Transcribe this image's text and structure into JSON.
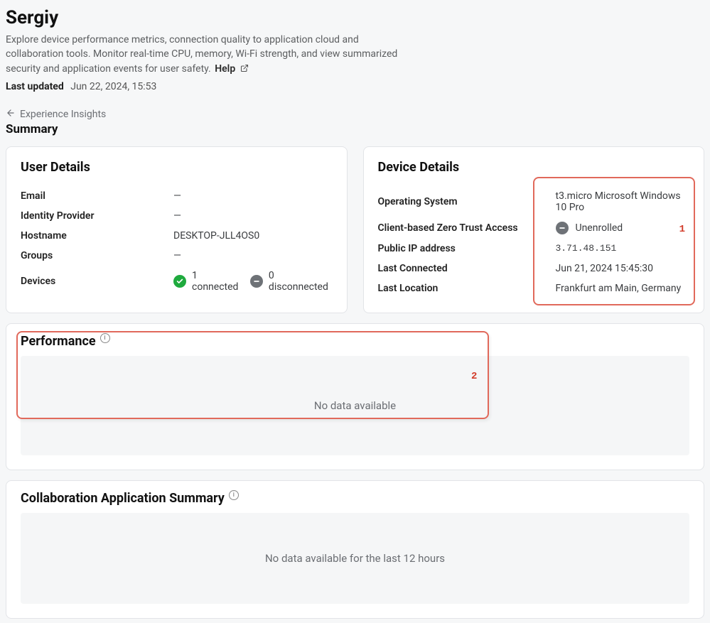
{
  "page": {
    "title": "Sergiy",
    "intro": "Explore device performance metrics, connection quality to application cloud and collaboration tools. Monitor real-time CPU, memory, Wi-Fi strength, and view summarized security and application events for user safety.",
    "help_label": "Help",
    "last_updated_label": "Last updated",
    "last_updated_value": "Jun 22, 2024, 15:53",
    "back_label": "Experience Insights",
    "section_title": "Summary"
  },
  "user_details": {
    "title": "User Details",
    "rows": [
      {
        "label": "Email",
        "value": "—"
      },
      {
        "label": "Identity Provider",
        "value": "—"
      },
      {
        "label": "Hostname",
        "value": "DESKTOP-JLL4OS0"
      },
      {
        "label": "Groups",
        "value": "—"
      }
    ],
    "devices_label": "Devices",
    "connected_text": "1 connected",
    "disconnected_text": "0 disconnected"
  },
  "device_details": {
    "title": "Device Details",
    "rows": [
      {
        "label": "Operating System",
        "value": "t3.micro Microsoft Windows 10 Pro"
      },
      {
        "label": "Client-based Zero Trust Access",
        "value": "Unenrolled",
        "status_icon": "minus"
      },
      {
        "label": "Public IP address",
        "value": "3.71.48.151",
        "mono": true
      },
      {
        "label": "Last Connected",
        "value": "Jun 21, 2024 15:45:30"
      },
      {
        "label": "Last Location",
        "value": "Frankfurt am Main, Germany"
      }
    ],
    "highlight_number": "1"
  },
  "performance": {
    "title": "Performance",
    "empty_text": "No data available",
    "highlight_number": "2"
  },
  "collab": {
    "title": "Collaboration Application Summary",
    "empty_text": "No data available for the last 12 hours"
  }
}
